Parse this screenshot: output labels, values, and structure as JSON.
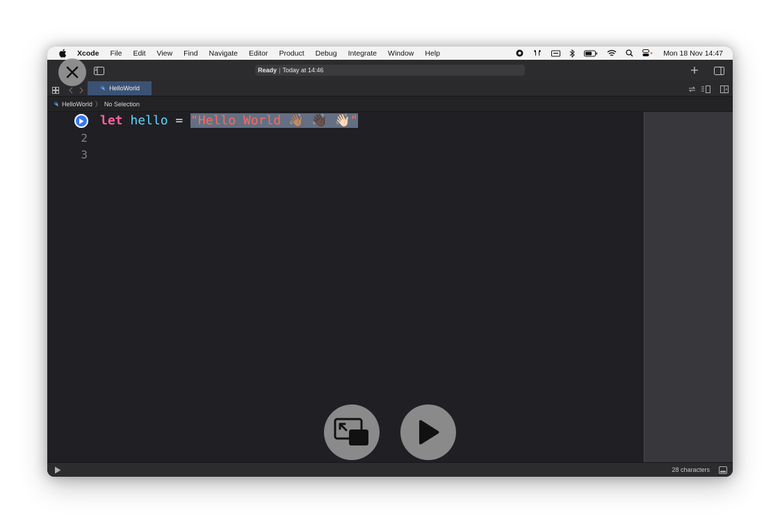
{
  "menubar": {
    "app_name": "Xcode",
    "items": [
      "File",
      "Edit",
      "View",
      "Find",
      "Navigate",
      "Editor",
      "Product",
      "Debug",
      "Integrate",
      "Window",
      "Help"
    ],
    "clock": "Mon 18 Nov  14:47"
  },
  "toolbar": {
    "status_ready": "Ready",
    "status_separator": "|",
    "status_time": "Today at 14:46"
  },
  "tabbar": {
    "active_tab": "HelloWorld"
  },
  "jumpbar": {
    "file": "HelloWorld",
    "selection": "No Selection"
  },
  "editor": {
    "line_numbers": [
      "2",
      "3"
    ],
    "code": {
      "keyword": "let",
      "identifier": "hello",
      "operator": "=",
      "string_literal": "\"Hello World 👋🏽 👋🏿 👋🏻\""
    }
  },
  "bottombar": {
    "char_count": "28 characters"
  },
  "colors": {
    "keyword": "#fc5fa3",
    "identifier": "#5dd8ff",
    "string": "#fc6a5d",
    "selection": "#646f83",
    "tab_active": "#3b5275",
    "run_marker": "#3478f6"
  }
}
